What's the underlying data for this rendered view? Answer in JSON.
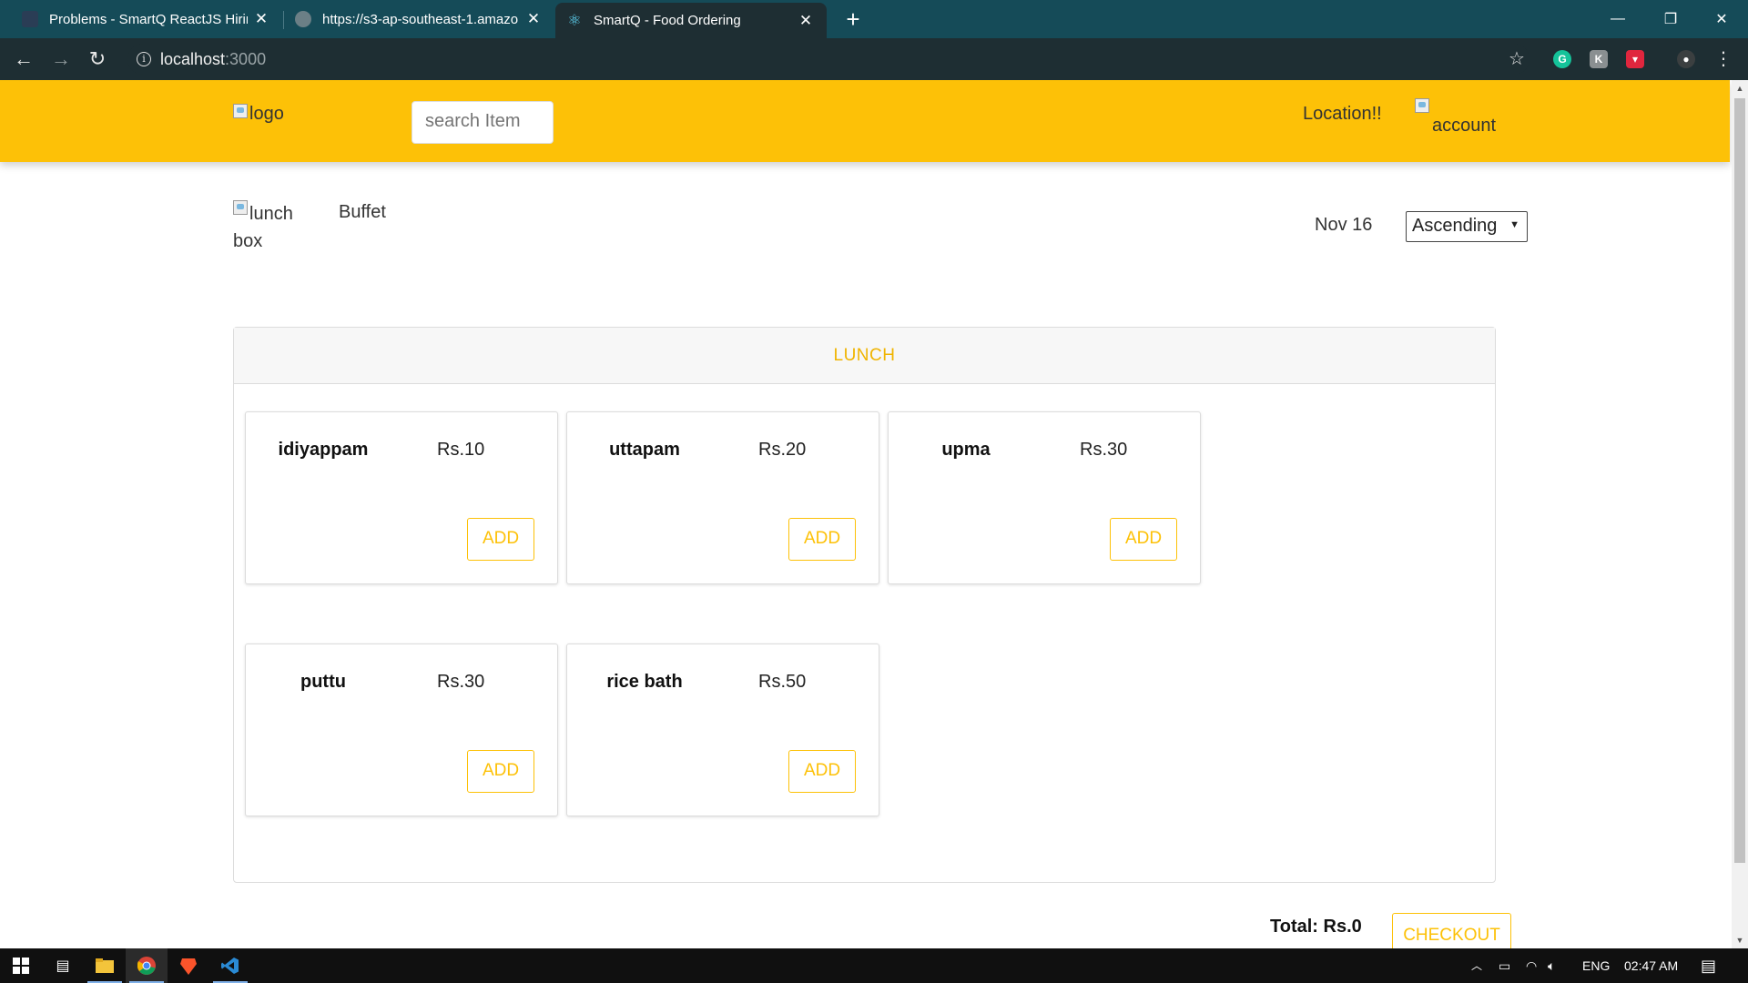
{
  "browser": {
    "tabs": [
      {
        "title": "Problems - SmartQ ReactJS Hirin",
        "favicon": "hackerearth-icon",
        "fav_color": "#2a3d55"
      },
      {
        "title": "https://s3-ap-southeast-1.amazo",
        "favicon": "globe-icon",
        "fav_color": "#6b7f86"
      },
      {
        "title": "SmartQ - Food Ordering",
        "favicon": "react-icon",
        "fav_color": "#1e2e33"
      }
    ],
    "url_host": "localhost",
    "url_port": ":3000"
  },
  "header": {
    "logo_alt": "logo",
    "search_placeholder": "search Item",
    "location": "Location!!",
    "account_alt": "account",
    "background": "#fdc107"
  },
  "subheader": {
    "lunchbox_alt": "lunch box",
    "buffet": "Buffet",
    "date": "Nov 16",
    "sort_value": "Ascending"
  },
  "menu": {
    "section_title": "LUNCH",
    "items": [
      {
        "name": "idiyappam",
        "price": "Rs.10",
        "button": "ADD"
      },
      {
        "name": "uttapam",
        "price": "Rs.20",
        "button": "ADD"
      },
      {
        "name": "upma",
        "price": "Rs.30",
        "button": "ADD"
      },
      {
        "name": "puttu",
        "price": "Rs.30",
        "button": "ADD"
      },
      {
        "name": "rice bath",
        "price": "Rs.50",
        "button": "ADD"
      }
    ]
  },
  "cart": {
    "total": "Total: Rs.0",
    "checkout": "CHECKOUT"
  },
  "taskbar": {
    "language": "ENG",
    "time": "02:47 AM"
  },
  "colors": {
    "accent": "#fdc107",
    "tabstrip": "#154b58",
    "toolbar": "#1e2e33"
  }
}
